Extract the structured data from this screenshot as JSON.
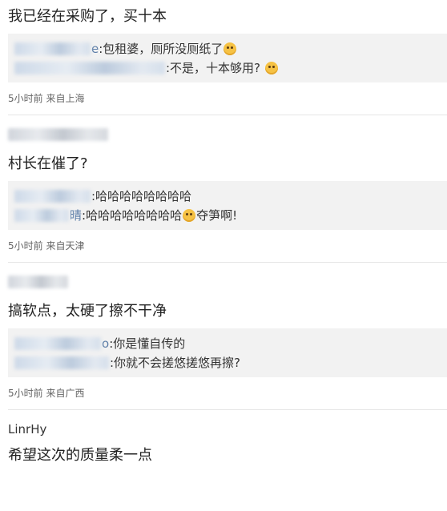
{
  "comments": [
    {
      "text": "我已经在采购了，买十本",
      "replies": [
        {
          "name_tail": "e",
          "text": ":包租婆，厕所没厕纸了",
          "emoji": "smile-emoji"
        },
        {
          "name_tail": "",
          "text": ":不是，十本够用?",
          "emoji": "smirk-emoji"
        }
      ],
      "meta": "5小时前 来自上海"
    },
    {
      "text": "村长在催了?",
      "replies": [
        {
          "name_tail": "",
          "text": ":哈哈哈哈哈哈哈哈"
        },
        {
          "name_tail": "晴",
          "text": ":哈哈哈哈哈哈哈哈",
          "emoji": "smile-emoji",
          "text_after": "夺笋啊!"
        }
      ],
      "meta": "5小时前 来自天津"
    },
    {
      "text": "搞软点，太硬了擦不干净",
      "replies": [
        {
          "name_tail": "o",
          "text": ":你是懂自传的"
        },
        {
          "name_tail": "",
          "text": ":你就不会搓悠搓悠再擦?"
        }
      ],
      "meta": "5小时前 来自广西"
    },
    {
      "username": "LinrHy",
      "text": "希望这次的质量柔一点"
    }
  ],
  "colors": {
    "reply_bg": "#f2f2f2",
    "meta": "#666666",
    "name_link": "#5d7ea8"
  }
}
